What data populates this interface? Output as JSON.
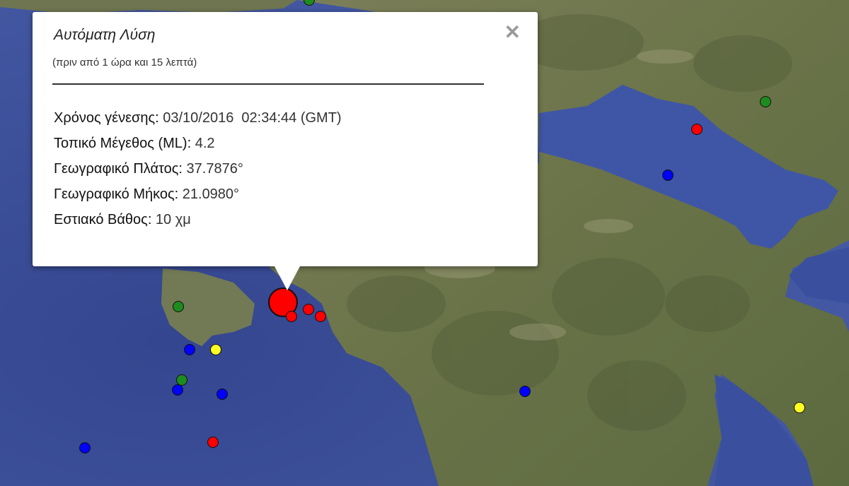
{
  "infowindow": {
    "title": "Αυτόματη Λύση",
    "subtitle": "(πριν από 1 ώρα και 15 λεπτά)",
    "close_icon": "close-icon",
    "rows": [
      {
        "label": "Χρόνος γένεσης:",
        "value": " 03/10/2016  02:34:44 (GMT)"
      },
      {
        "label": "Τοπικό Μέγεθος (ML):",
        "value": " 4.2"
      },
      {
        "label": "Γεωγραφικό Πλάτος:",
        "value": " 37.7876°"
      },
      {
        "label": "Γεωγραφικό Μήκος:",
        "value": " 21.0980°"
      },
      {
        "label": "Εστιακό Βάθος:",
        "value": " 10 χμ"
      }
    ]
  },
  "marker_colors": {
    "red": "#ff0000",
    "blue": "#0000ff",
    "green": "#1e8b1e",
    "yellow": "#ffff22"
  },
  "map_colors": {
    "sea": "#3b4f9a",
    "land": "#6f7652"
  }
}
